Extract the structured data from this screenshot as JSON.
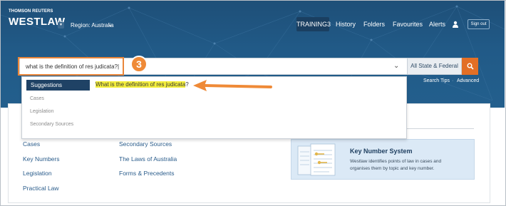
{
  "header": {
    "brand_top": "THOMSON REUTERS",
    "brand": "WESTLAW",
    "brand_menu_icon": "chevron-down-icon",
    "region": "Region: Australia",
    "region_icon": "chevron-down-icon",
    "nav": {
      "training": "TRAINING3",
      "history": "History",
      "folders": "Folders",
      "favourites": "Favourites",
      "alerts": "Alerts"
    },
    "user_icon": "user-icon",
    "signout": "Sign out"
  },
  "search": {
    "value": "what is the definition of res judicata?|",
    "dropdown_icon": "chevron-down-icon",
    "jurisdiction": "All State & Federal",
    "search_icon": "search-icon",
    "tips": "Search Tips",
    "separator": "·",
    "advanced": "Advanced"
  },
  "annotation": {
    "step": "3",
    "color": "#e9863a"
  },
  "suggestions": {
    "tab": "Suggestions",
    "categories": [
      "Cases",
      "Legislation",
      "Secondary Sources"
    ],
    "suggestion_highlight": "What is the definition of res judicata",
    "suggestion_tail": "?"
  },
  "content": {
    "links_col1": [
      "Cases",
      "Key Numbers",
      "Legislation",
      "Practical Law"
    ],
    "links_col2": [
      "Secondary Sources",
      "The Laws of Australia",
      "Forms & Precedents"
    ],
    "key_number": {
      "title": "Key Number System",
      "desc_line1": "Westlaw identifies points of law in cases and",
      "desc_line2": "organises them by topic and key number."
    }
  },
  "colors": {
    "header": "#215a87",
    "accent_orange": "#e26f26",
    "link": "#2a5c8b",
    "highlight": "#f4ef3c",
    "suggestion_tab": "#1f4265"
  }
}
